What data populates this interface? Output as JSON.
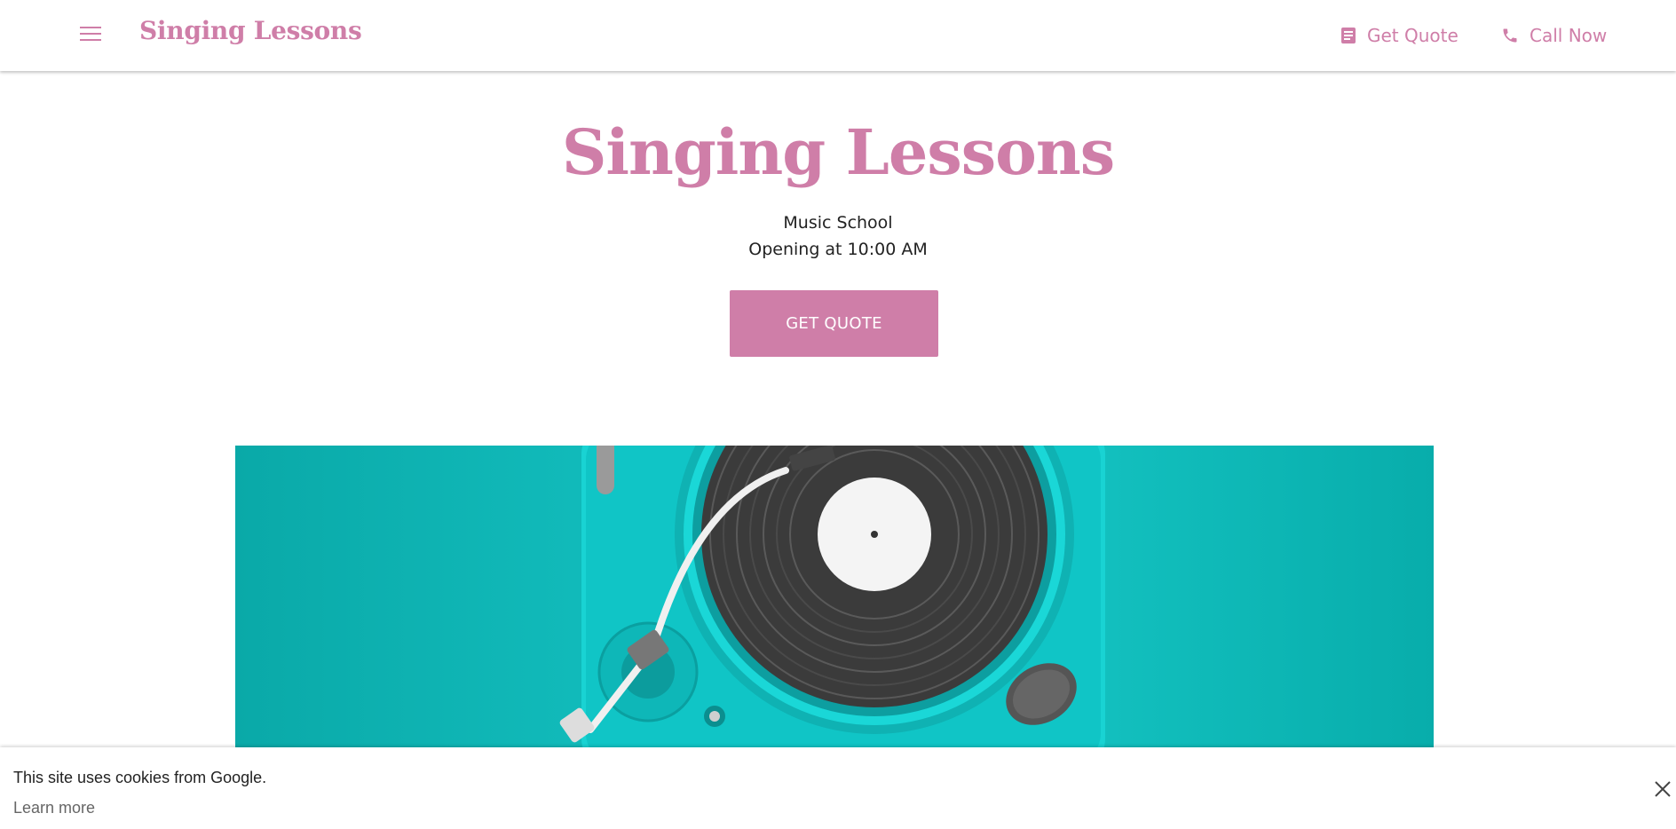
{
  "header": {
    "brand": "Singing Lessons",
    "menu_icon": "menu-icon",
    "actions": [
      {
        "label": "Get Quote",
        "icon": "quote-icon"
      },
      {
        "label": "Call Now",
        "icon": "phone-icon"
      }
    ]
  },
  "hero": {
    "title": "Singing Lessons",
    "category": "Music School",
    "hours": "Opening at 10:00 AM",
    "cta_label": "GET QUOTE",
    "image": "turntable-image"
  },
  "cookie": {
    "text": "This site uses cookies from Google.",
    "link": "Learn more",
    "close_icon": "close-icon"
  },
  "colors": {
    "accent": "#cf7ea8",
    "image_bg": "#14c1c1"
  }
}
